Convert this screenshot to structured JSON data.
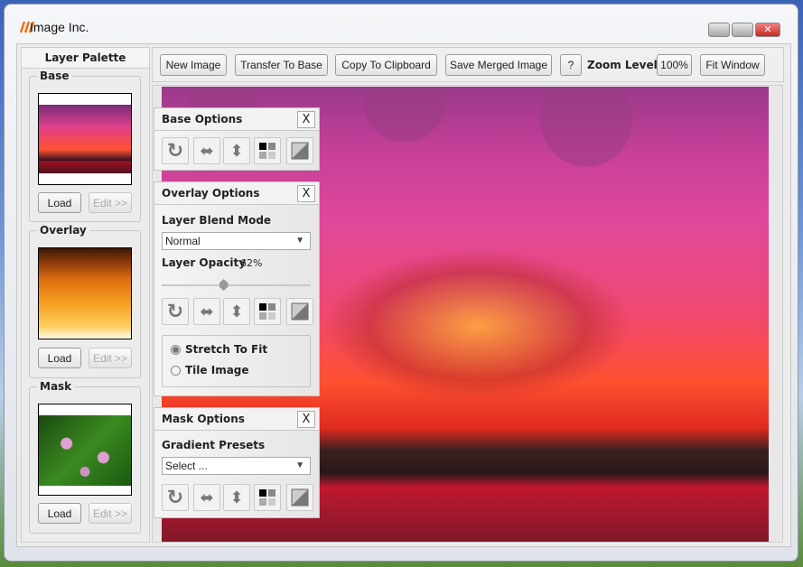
{
  "window": {
    "title": "Image Inc."
  },
  "palette": {
    "title": "Layer Palette",
    "groups": [
      {
        "label": "Base",
        "load": "Load",
        "edit": "Edit >>"
      },
      {
        "label": "Overlay",
        "load": "Load",
        "edit": "Edit >>"
      },
      {
        "label": "Mask",
        "load": "Load",
        "edit": "Edit >>"
      }
    ]
  },
  "toolbar": {
    "new_image": "New Image",
    "transfer": "Transfer To Base",
    "copy": "Copy To Clipboard",
    "save": "Save Merged Image",
    "help": "?",
    "zoom_label": "Zoom Level",
    "zoom_value": "100%",
    "fit": "Fit Window"
  },
  "base_options": {
    "title": "Base Options",
    "close": "X"
  },
  "overlay_options": {
    "title": "Overlay Options",
    "close": "X",
    "blend_label": "Layer Blend Mode",
    "blend_value": "Normal",
    "opacity_label": "Layer Opacity",
    "opacity_value": "62%",
    "opacity": 62,
    "radios": [
      {
        "label": "Stretch To Fit",
        "checked": true
      },
      {
        "label": "Tile Image",
        "checked": false
      }
    ]
  },
  "mask_options": {
    "title": "Mask Options",
    "close": "X",
    "gradient_label": "Gradient Presets",
    "gradient_value": "Select ..."
  }
}
